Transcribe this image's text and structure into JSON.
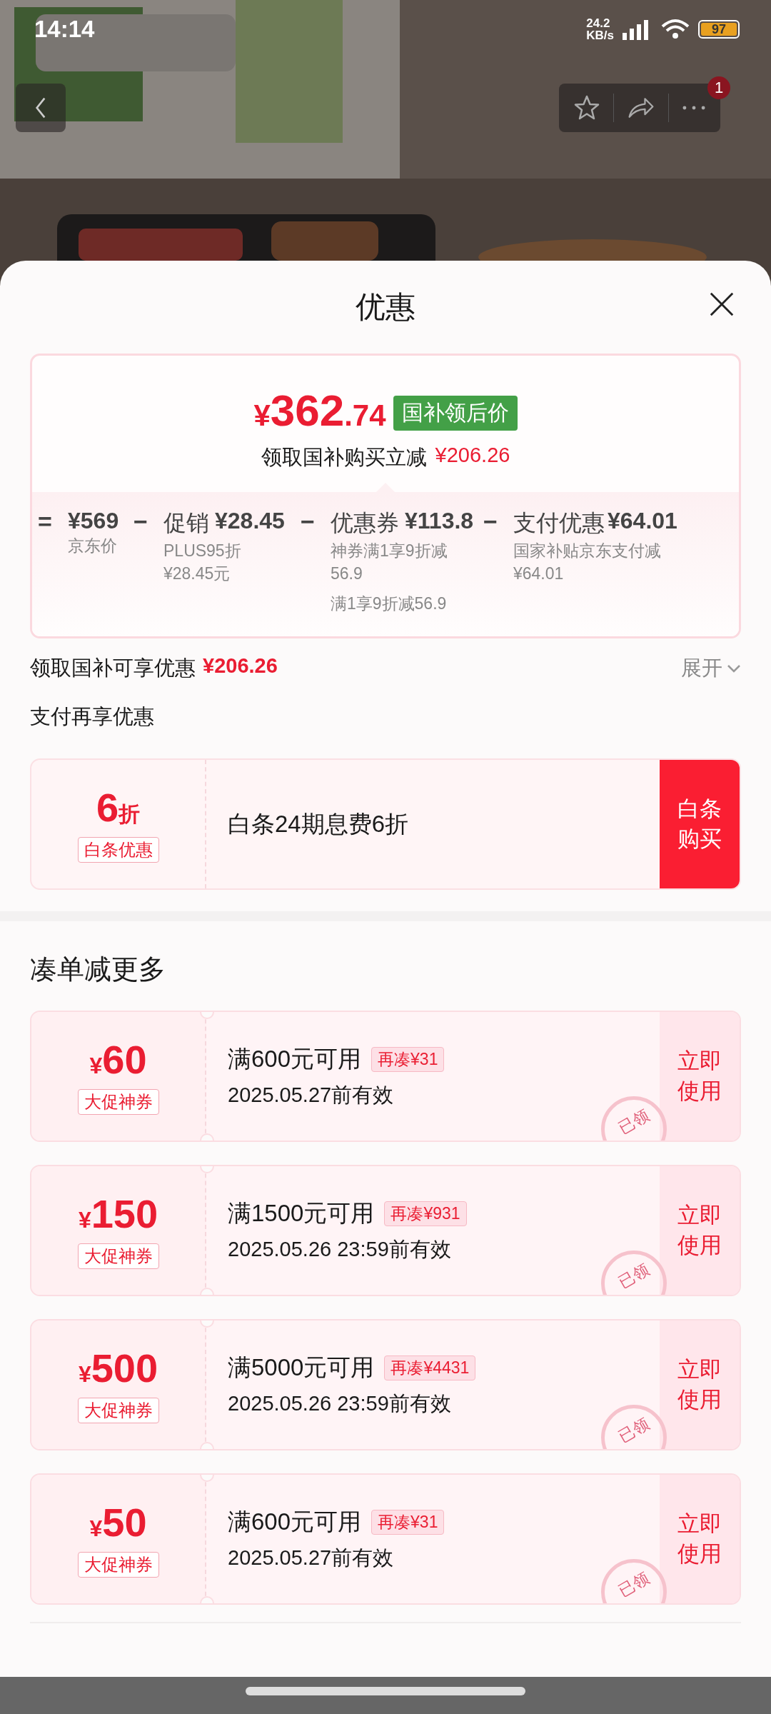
{
  "status_bar": {
    "time": "14:14",
    "net_speed": [
      "24.2",
      "KB/s"
    ],
    "battery": "97"
  },
  "header": {
    "badge": "1"
  },
  "sheet": {
    "title": "优惠"
  },
  "price_card": {
    "currency": "¥",
    "price_int": "362",
    "price_dec": ".74",
    "tag": "国补领后价",
    "subtitle": "领取国补购买立减",
    "subtitle_amount": "¥206.26",
    "breakdown": [
      {
        "op": "=",
        "amount": "¥569",
        "notes": [
          [
            "京东价"
          ]
        ]
      },
      {
        "op": "−",
        "label": "促销",
        "amount": "¥28.45",
        "notes": [
          [
            "PLUS95折",
            "¥28.45元"
          ]
        ]
      },
      {
        "op": "−",
        "label": "优惠券",
        "amount": "¥113.8",
        "notes": [
          [
            "神券满1享9折减",
            "56.9"
          ],
          [
            "满1享9折减56.9"
          ]
        ]
      },
      {
        "op": "−",
        "label": "支付优惠",
        "amount": "¥64.01",
        "notes": [
          [
            "国家补贴京东支付减",
            "¥64.01"
          ]
        ]
      }
    ]
  },
  "subsidy_row": {
    "label": "领取国补可享优惠",
    "amount": "¥206.26",
    "toggle": "展开"
  },
  "payment": {
    "title": "支付再享优惠",
    "discount": "6",
    "discount_unit": "折",
    "tag": "白条优惠",
    "text": "白条24期息费6折",
    "button": "白条购买"
  },
  "coupons": {
    "title": "凑单减更多",
    "items": [
      {
        "currency": "¥",
        "amount": "60",
        "tag": "大促神券",
        "condition": "满600元可用",
        "extra": "再凑¥31",
        "validity": "2025.05.27前有效",
        "action": "立即使用",
        "stamp": "已领"
      },
      {
        "currency": "¥",
        "amount": "150",
        "tag": "大促神券",
        "condition": "满1500元可用",
        "extra": "再凑¥931",
        "validity": "2025.05.26 23:59前有效",
        "action": "立即使用",
        "stamp": "已领"
      },
      {
        "currency": "¥",
        "amount": "500",
        "tag": "大促神券",
        "condition": "满5000元可用",
        "extra": "再凑¥4431",
        "validity": "2025.05.26 23:59前有效",
        "action": "立即使用",
        "stamp": "已领"
      },
      {
        "currency": "¥",
        "amount": "50",
        "tag": "大促神券",
        "condition": "满600元可用",
        "extra": "再凑¥31",
        "validity": "2025.05.27前有效",
        "action": "立即使用",
        "stamp": "已领"
      }
    ]
  }
}
